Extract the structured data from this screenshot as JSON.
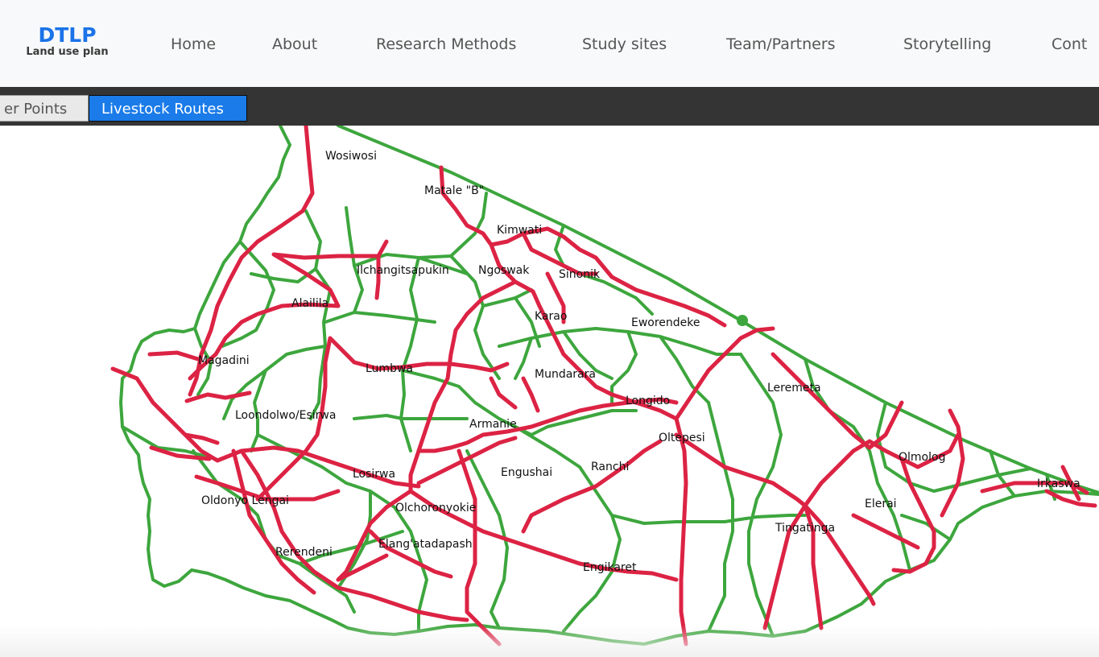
{
  "brand": {
    "title": "DTLP",
    "subtitle": "Land use plan"
  },
  "nav": {
    "items": [
      {
        "label": "Home",
        "id": "home"
      },
      {
        "label": "About",
        "id": "about"
      },
      {
        "label": "Research Methods",
        "id": "research-methods"
      },
      {
        "label": "Study sites",
        "id": "study-sites"
      },
      {
        "label": "Team/Partners",
        "id": "team-partners"
      },
      {
        "label": "Storytelling",
        "id": "storytelling"
      },
      {
        "label": "Cont",
        "id": "contact"
      }
    ]
  },
  "layer_tabs": [
    {
      "label": "er Points",
      "active": false
    },
    {
      "label": "Livestock Routes",
      "active": true
    }
  ],
  "map": {
    "boundary_color": "#3da63d",
    "route_color": "#dc2344",
    "labels": [
      "Wosiwosi",
      "Matale \"B\"",
      "Kimwati",
      "Ilchangitsapukin",
      "Ngoswak",
      "Sinonik",
      "Alailila",
      "Karao",
      "Eworendeke",
      "Magadini",
      "Lumbwa",
      "Mundarara",
      "Leremeta",
      "Longido",
      "Loondolwo/Esirwa",
      "Armanie",
      "Oltepesi",
      "Olmolog",
      "Engushai",
      "Ranchi",
      "Losirwa",
      "Irkaswa",
      "Oldonyo Lengai",
      "Olchoronyokie",
      "Elerai",
      "Tingatinga",
      "Rerendeni",
      "Elang'atadapash",
      "Engikaret"
    ]
  }
}
